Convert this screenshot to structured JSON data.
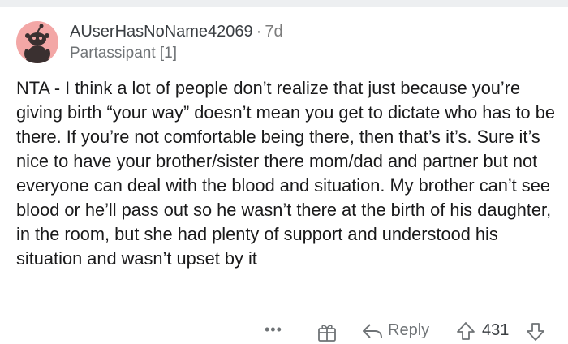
{
  "comment": {
    "author": "AUserHasNoName42069",
    "separator": "·",
    "age": "7d",
    "flair": "Partassipant [1]",
    "body": "NTA - I think a lot of people don’t realize that just because you’re giving birth “your way” doesn’t mean you get to dictate who has to be there. If you’re not comfortable being there, then that’s it’s. Sure it’s nice to have your brother/sister there mom/dad and partner but not everyone can deal with the blood and situation. My brother can’t see blood or he’ll pass out so he wasn’t there at the birth of his daughter, in the room, but she had plenty of support and understood his situation and wasn’t upset by it"
  },
  "actions": {
    "more_label": "•••",
    "reply_label": "Reply",
    "score": "431"
  },
  "icons": {
    "avatar": "snoo-avatar-icon",
    "gift": "gift-icon",
    "reply": "reply-arrow-icon",
    "upvote": "upvote-arrow-icon",
    "downvote": "downvote-arrow-icon"
  },
  "colors": {
    "avatar_bg": "#f3a7a6",
    "muted_text": "#6f7376",
    "body_text": "#1a1a1b"
  }
}
